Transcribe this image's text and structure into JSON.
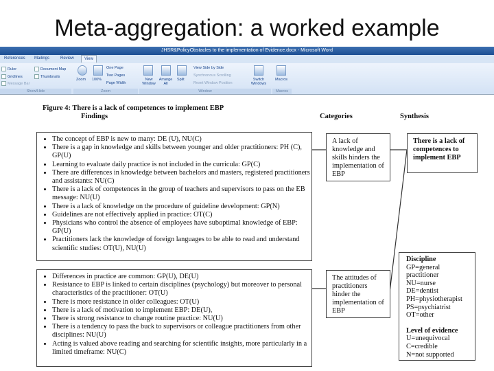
{
  "slide_title": "Meta-aggregation: a worked example",
  "window_title": "JHSR&PolicyObstacles to the implementation of Evidence.docx - Microsoft Word",
  "tabs": [
    "References",
    "Mailings",
    "Review",
    "View"
  ],
  "ribbon": {
    "show_hide": {
      "items": [
        "Ruler",
        "Gridlines",
        "Message Bar",
        "Document Map",
        "Thumbnails"
      ],
      "label": "Show/Hide"
    },
    "zoom": {
      "items": [
        "Zoom",
        "100%",
        "One Page",
        "Two Pages",
        "Page Width"
      ],
      "label": "Zoom"
    },
    "window": {
      "items": [
        "New Window",
        "Arrange All",
        "Split",
        "View Side by Side",
        "Synchronous Scrolling",
        "Reset Window Position",
        "Switch Windows"
      ],
      "label": "Window"
    },
    "macros": {
      "items": [
        "Macros"
      ],
      "label": "Macros"
    }
  },
  "figure_title": "Figure 4: There is a lack of competences to implement EBP",
  "headers": {
    "findings": "Findings",
    "categories": "Categories",
    "synthesis": "Synthesis"
  },
  "findings_1": [
    "The concept of EBP is new to many: DE (U), NU(C)",
    "There is a gap in knowledge and skills between younger and older practitioners: PH (C), GP(U)",
    "Learning to evaluate daily practice is not included in the curricula: GP(C)",
    "There are differences in knowledge between bachelors and masters, registered practitioners and assistants: NU(C)",
    "There is a lack of competences in the group of teachers and supervisors to pass on the EB message: NU(U)",
    "There is a lack of knowledge on the procedure of guideline development: GP(N)",
    "Guidelines are not effectively applied in practice: OT(C)",
    "Physicians who control the absence of employees have suboptimal knowledge of EBP: GP(U)",
    "Practitioners lack the knowledge of foreign languages to be able to read and understand scientific studies: OT(U), NU(U)"
  ],
  "findings_2": [
    "Differences in practice are common: GP(U), DE(U)",
    "Resistance to EBP is linked to certain disciplines (psychology) but moreover to personal characteristics of the practitioner: OT(U)",
    "There is more resistance in older colleagues: OT(U)",
    "There is a lack of motivation to implement EBP: DE(U),",
    "There is strong resistance to change routine practice: NU(U)",
    "There is a tendency to pass the buck to supervisors or colleague practitioners from other disciplines: NU(U)",
    "Acting is valued above reading and searching for scientific insights, more particularly in a limited timeframe: NU(C)"
  ],
  "categories": [
    "A lack of knowledge and skills hinders the implementation of EBP",
    "The attitudes of practitioners hinder the implementation of EBP"
  ],
  "synthesis": "There is a lack of competences to implement EBP",
  "legend": {
    "discipline_title": "Discipline",
    "discipline": [
      "GP=general practitioner",
      "NU=nurse",
      "DE=dentist",
      "PH=physiotherapist",
      "PS=psychiatrist",
      "OT=other"
    ],
    "evidence_title": "Level of evidence",
    "evidence": [
      "U=unequivocal",
      "C=credible",
      "N=not supported"
    ]
  }
}
